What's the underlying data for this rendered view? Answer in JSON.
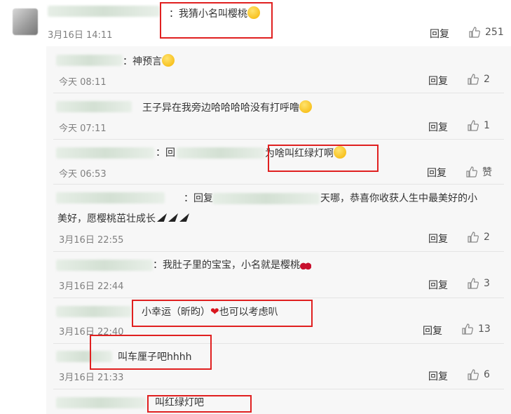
{
  "top_comment": {
    "text": "：我猜小名叫樱桃",
    "time": "3月16日 14:11",
    "reply": "回复",
    "likes": "251"
  },
  "replies": [
    {
      "text": "：神预言",
      "time": "今天 08:11",
      "reply": "回复",
      "likes": "2"
    },
    {
      "text": "王子异在我旁边哈哈哈哈没有打呼噜",
      "time": "今天 07:11",
      "reply": "回复",
      "likes": "1"
    },
    {
      "prefix": "：回",
      "text": "为啥叫红绿灯啊",
      "time": "今天 06:53",
      "reply": "回复",
      "likes": "赞"
    },
    {
      "prefix": "：回复",
      "text": "天哪，恭喜你收获人生中最美好的小",
      "text2": "美好，愿樱桃茁壮成长",
      "time": "3月16日 22:55",
      "reply": "回复",
      "likes": "2"
    },
    {
      "text": "：我肚子里的宝宝，小名就是樱桃",
      "time": "3月16日 22:44",
      "reply": "回复",
      "likes": "3"
    },
    {
      "text": "小幸运（昕昀）",
      "text_b": "也可以考虑叭",
      "time": "3月16日 22:40",
      "reply": "回复",
      "likes": "13"
    },
    {
      "text": "叫车厘子吧hhhh",
      "time": "3月16日 21:33",
      "reply": "回复",
      "likes": "6"
    },
    {
      "text": "叫红绿灯吧"
    }
  ]
}
